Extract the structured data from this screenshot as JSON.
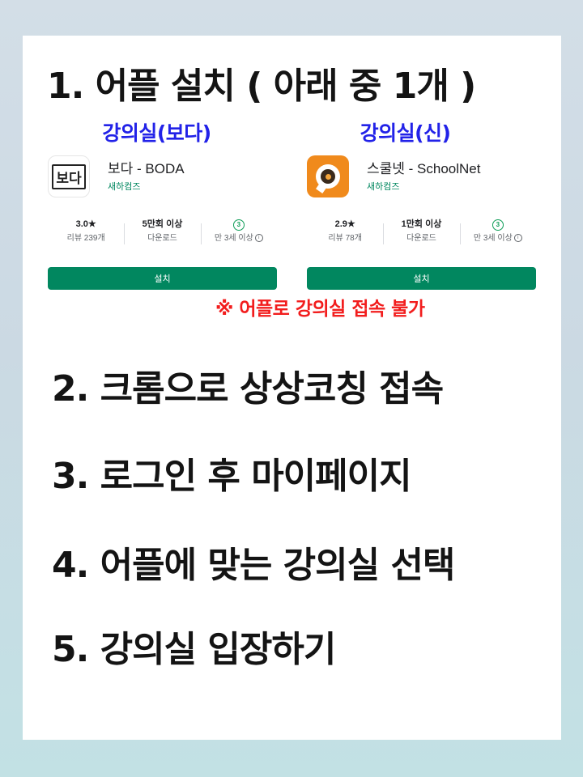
{
  "steps": {
    "step1": "1. 어플 설치 ( 아래 중 1개 )",
    "step2": "2. 크롬으로 상상코칭 접속",
    "step3": "3. 로그인 후 마이페이지",
    "step4": "4. 어플에 맞는 강의실 선택",
    "step5": "5. 강의실 입장하기"
  },
  "apps": [
    {
      "heading": "강의실(보다)",
      "icon_text": "보다",
      "title": "보다 - BODA",
      "developer": "새하컴즈",
      "rating": "3.0★",
      "reviews": "리뷰 239개",
      "downloads": "5만회 이상",
      "downloads_label": "다운로드",
      "age_badge": "3",
      "age_label": "만 3세 이상",
      "install_label": "설치"
    },
    {
      "heading": "강의실(신)",
      "icon_text": "",
      "title": "스쿨넷 - SchoolNet",
      "developer": "새하컴즈",
      "rating": "2.9★",
      "reviews": "리뷰 78개",
      "downloads": "1만회 이상",
      "downloads_label": "다운로드",
      "age_badge": "3",
      "age_label": "만 3세 이상",
      "install_label": "설치"
    }
  ],
  "warning": "※ 어플로 강의실 접속 불가",
  "colors": {
    "heading_blue": "#2222e8",
    "warning_red": "#f21d1d",
    "install_green": "#01875f",
    "developer_green": "#01875f",
    "school_icon_orange": "#f08a1c"
  },
  "icons": [
    "boda-app-icon",
    "schoolnet-app-icon",
    "age-rating-icon",
    "info-icon"
  ]
}
